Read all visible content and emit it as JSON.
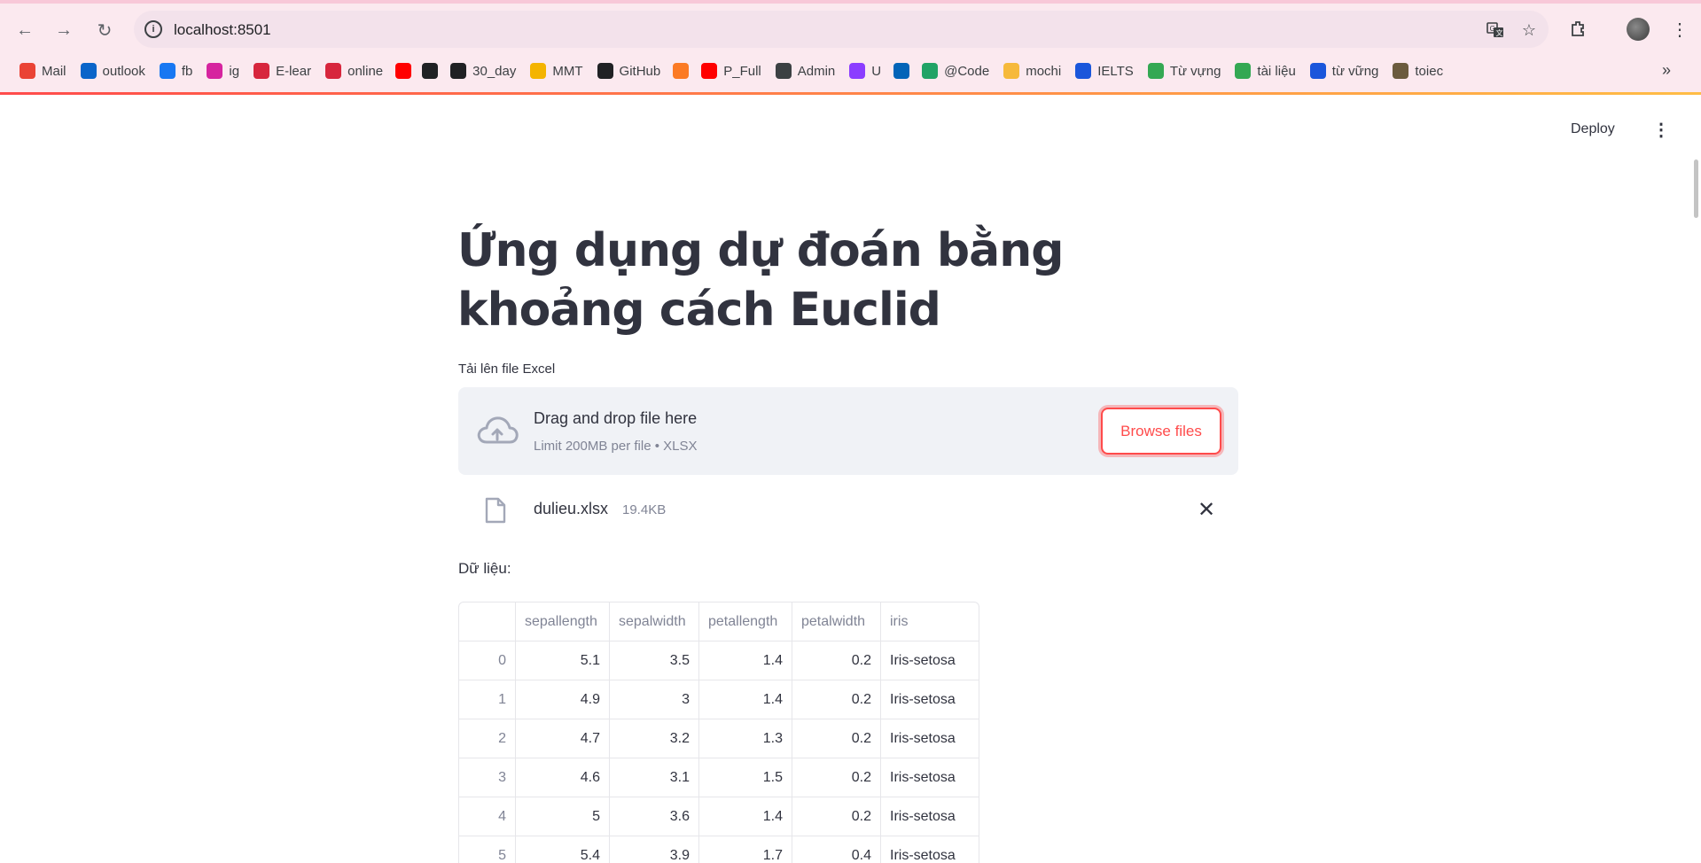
{
  "browser": {
    "url": "localhost:8501",
    "bookmarks": [
      {
        "label": "Mail",
        "icon": "gmail-icon",
        "color": "#ea4335"
      },
      {
        "label": "outlook",
        "icon": "outlook-icon",
        "color": "#0a64c9"
      },
      {
        "label": "fb",
        "icon": "facebook-icon",
        "color": "#1877f2"
      },
      {
        "label": "ig",
        "icon": "instagram-icon",
        "color": "#d6249f"
      },
      {
        "label": "E-lear",
        "icon": "shield-icon",
        "color": "#d7263d"
      },
      {
        "label": "online",
        "icon": "shield-icon",
        "color": "#d7263d"
      },
      {
        "label": "",
        "icon": "youtube-icon",
        "color": "#ff0000"
      },
      {
        "label": "",
        "icon": "openai-icon",
        "color": "#202124"
      },
      {
        "label": "30_day",
        "icon": "github-icon",
        "color": "#202124"
      },
      {
        "label": "MMT",
        "icon": "classroom-icon",
        "color": "#f4b400"
      },
      {
        "label": "GitHub",
        "icon": "github-icon",
        "color": "#202124"
      },
      {
        "label": "",
        "icon": "xampp-icon",
        "color": "#fb7a24"
      },
      {
        "label": "P_Full",
        "icon": "youtube-icon",
        "color": "#ff0000"
      },
      {
        "label": "Admin",
        "icon": "globe-icon",
        "color": "#3c4043"
      },
      {
        "label": "U",
        "icon": "u-icon",
        "color": "#8b3dff"
      },
      {
        "label": "",
        "icon": "onedrive-icon",
        "color": "#0364b8"
      },
      {
        "label": "@Code",
        "icon": "code-icon",
        "color": "#21a366"
      },
      {
        "label": "mochi",
        "icon": "mochi-icon",
        "color": "#f6b93b"
      },
      {
        "label": "IELTS",
        "icon": "ielts-icon",
        "color": "#1a56db"
      },
      {
        "label": "Từ vựng",
        "icon": "globe-icon",
        "color": "#34a853"
      },
      {
        "label": "tài liệu",
        "icon": "drive-icon",
        "color": "#34a853"
      },
      {
        "label": "từ vững",
        "icon": "circle-icon",
        "color": "#1a56db"
      },
      {
        "label": "toiec",
        "icon": "t-icon",
        "color": "#6b5b3e"
      }
    ]
  },
  "app": {
    "deploy_label": "Deploy",
    "title": "Ứng dụng dự đoán bằng khoảng cách Euclid",
    "uploader": {
      "label": "Tải lên file Excel",
      "drag_text": "Drag and drop file here",
      "limit_text": "Limit 200MB per file • XLSX",
      "browse_label": "Browse files"
    },
    "file": {
      "name": "dulieu.xlsx",
      "size": "19.4KB"
    },
    "data_label": "Dữ liệu:",
    "table": {
      "columns": [
        "",
        "sepallength",
        "sepalwidth",
        "petallength",
        "petalwidth",
        "iris"
      ],
      "rows": [
        [
          "0",
          "5.1",
          "3.5",
          "1.4",
          "0.2",
          "Iris-setosa"
        ],
        [
          "1",
          "4.9",
          "3",
          "1.4",
          "0.2",
          "Iris-setosa"
        ],
        [
          "2",
          "4.7",
          "3.2",
          "1.3",
          "0.2",
          "Iris-setosa"
        ],
        [
          "3",
          "4.6",
          "3.1",
          "1.5",
          "0.2",
          "Iris-setosa"
        ],
        [
          "4",
          "5",
          "3.6",
          "1.4",
          "0.2",
          "Iris-setosa"
        ],
        [
          "5",
          "5.4",
          "3.9",
          "1.7",
          "0.4",
          "Iris-setosa"
        ]
      ]
    }
  }
}
